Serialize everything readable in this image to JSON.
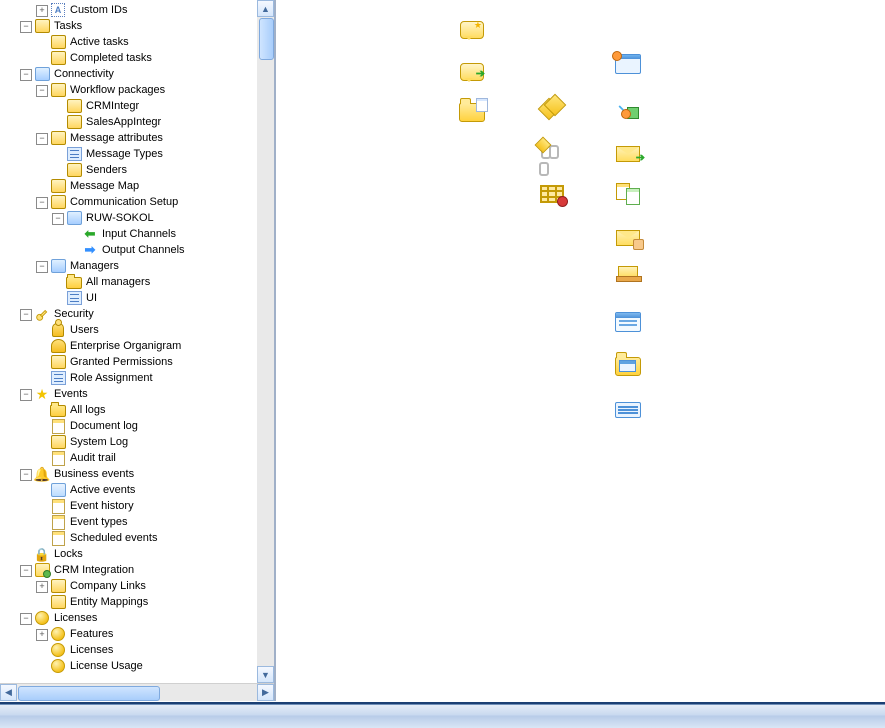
{
  "tree": {
    "custom_ids": "Custom IDs",
    "tasks": "Tasks",
    "tasks_active": "Active tasks",
    "tasks_completed": "Completed tasks",
    "connectivity": "Connectivity",
    "wf_packages": "Workflow packages",
    "wf_crmintegr": "CRMIntegr",
    "wf_salesapp": "SalesAppIntegr",
    "msg_attr": "Message attributes",
    "msg_types": "Message Types",
    "senders": "Senders",
    "msg_map": "Message Map",
    "comm_setup": "Communication Setup",
    "ruw_sokol": "RUW-SOKOL",
    "input_ch": "Input Channels",
    "output_ch": "Output Channels",
    "managers": "Managers",
    "all_managers": "All managers",
    "ui": "UI",
    "security": "Security",
    "users": "Users",
    "enterprise_org": "Enterprise Organigram",
    "granted_perm": "Granted Permissions",
    "role_assign": "Role Assignment",
    "events": "Events",
    "all_logs": "All logs",
    "doc_log": "Document log",
    "system_log": "System Log",
    "audit_trail": "Audit trail",
    "bus_events": "Business events",
    "active_events": "Active events",
    "event_history": "Event history",
    "event_types": "Event types",
    "sched_events": "Scheduled events",
    "locks": "Locks",
    "crm_integr": "CRM Integration",
    "company_links": "Company Links",
    "entity_mappings": "Entity Mappings",
    "licenses": "Licenses",
    "features": "Features",
    "licenses_child": "Licenses",
    "license_usage": "License Usage"
  }
}
